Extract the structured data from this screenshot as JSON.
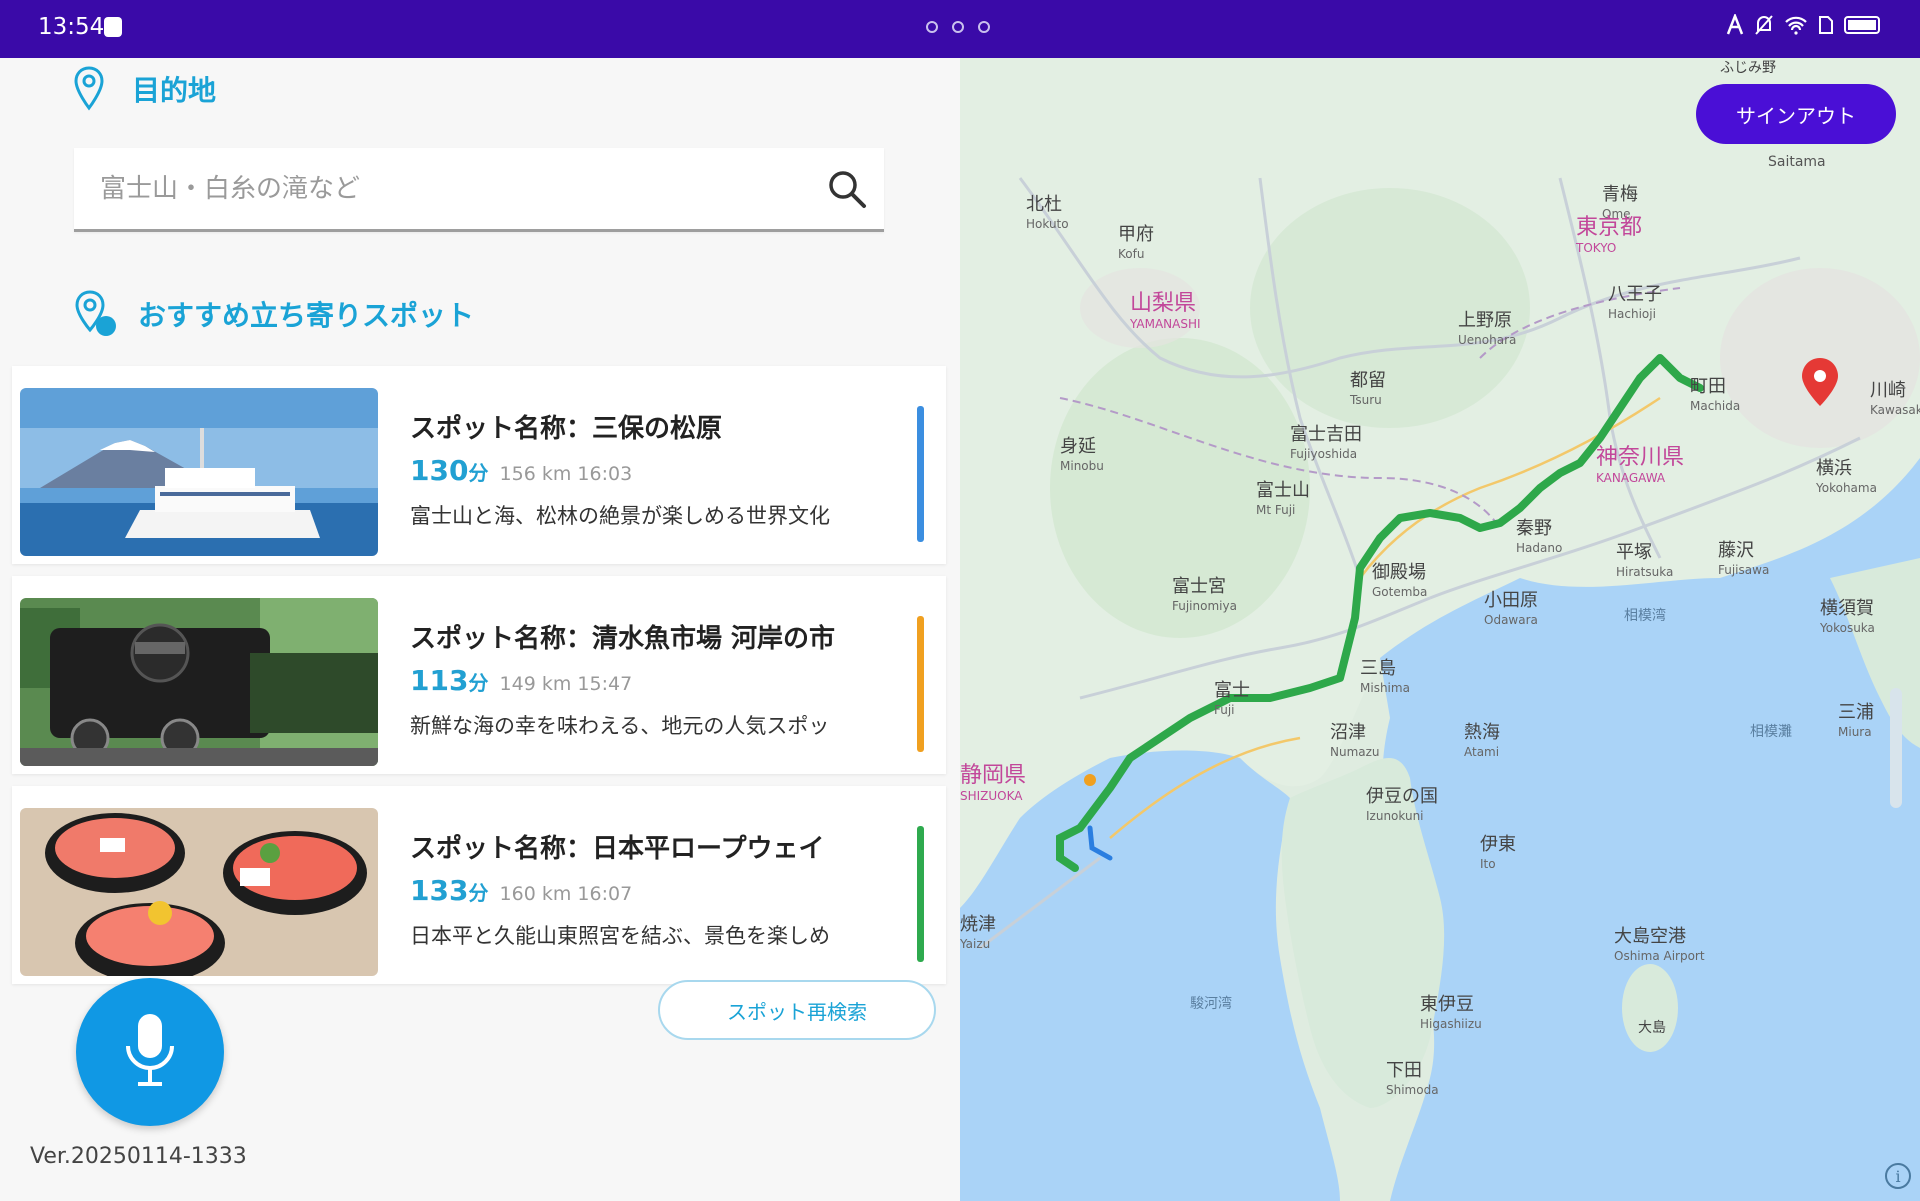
{
  "status_bar": {
    "time": "13:54"
  },
  "destination": {
    "label": "目的地",
    "search_placeholder": "富士山・白糸の滝など"
  },
  "recommended": {
    "label": "おすすめ立ち寄りスポット",
    "spots": [
      {
        "name": "スポット名称：三保の松原",
        "minutes": "130",
        "unit": "分",
        "distance_time": "156 km 16:03",
        "description": "富士山と海、松林の絶景が楽しめる世界文化",
        "accent": "#3b8ee0"
      },
      {
        "name": "スポット名称：清水魚市場 河岸の市",
        "minutes": "113",
        "unit": "分",
        "distance_time": "149 km 15:47",
        "description": "新鮮な海の幸を味わえる、地元の人気スポッ",
        "accent": "#f0a020"
      },
      {
        "name": "スポット名称：日本平ロープウェイ",
        "minutes": "133",
        "unit": "分",
        "distance_time": "160 km 16:07",
        "description": "日本平と久能山東照宮を結ぶ、景色を楽しめ",
        "accent": "#2eaa4e"
      }
    ]
  },
  "research_button": "スポット再検索",
  "version": "Ver.20250114-1333",
  "signout_button": "サインアウト",
  "map": {
    "labels": {
      "hokuto_ja": "北杜",
      "hokuto_en": "Hokuto",
      "kofu_ja": "甲府",
      "kofu_en": "Kofu",
      "yamanashi_ja": "山梨県",
      "yamanashi_en": "YAMANASHI",
      "ome_ja": "青梅",
      "ome_en": "Ome",
      "tokyo_ja": "東京都",
      "tokyo_en": "TOKYO",
      "hachioji_ja": "八王子",
      "hachioji_en": "Hachioji",
      "uenohara_ja": "上野原",
      "uenohara_en": "Uenohara",
      "tsuru_ja": "都留",
      "tsuru_en": "Tsuru",
      "fujiyoshida_ja": "富士吉田",
      "fujiyoshida_en": "Fujiyoshida",
      "minobu_ja": "身延",
      "minobu_en": "Minobu",
      "fujisan_ja": "富士山",
      "fujisan_en": "Mt Fuji",
      "fujinomiya_ja": "富士宮",
      "fujinomiya_en": "Fujinomiya",
      "gotemba_ja": "御殿場",
      "gotemba_en": "Gotemba",
      "machida_ja": "町田",
      "machida_en": "Machida",
      "kanagawa_ja": "神奈川県",
      "kanagawa_en": "KANAGAWA",
      "yokohama_ja": "横浜",
      "yokohama_en": "Yokohama",
      "kawasaki_ja": "川崎",
      "kawasaki_en": "Kawasaki",
      "hadano_ja": "秦野",
      "hadano_en": "Hadano",
      "hiratsuka_ja": "平塚",
      "hiratsuka_en": "Hiratsuka",
      "fujisawa_ja": "藤沢",
      "fujisawa_en": "Fujisawa",
      "odawara_ja": "小田原",
      "odawara_en": "Odawara",
      "sagamiwan": "相模湾",
      "yokosuka_ja": "横須賀",
      "yokosuka_en": "Yokosuka",
      "miura_ja": "三浦",
      "miura_en": "Miura",
      "fuji_ja": "富士",
      "fuji_en": "Fuji",
      "mishima_ja": "三島",
      "mishima_en": "Mishima",
      "numazu_ja": "沼津",
      "numazu_en": "Numazu",
      "atami_ja": "熱海",
      "atami_en": "Atami",
      "izunokuni_ja": "伊豆の国",
      "izunokuni_en": "Izunokuni",
      "ito_ja": "伊東",
      "ito_en": "Ito",
      "shizuoka_ja": "静岡県",
      "shizuoka_en": "SHIZUOKA",
      "yaizu_ja": "焼津",
      "yaizu_en": "Yaizu",
      "higashiizu_ja": "東伊豆",
      "higashiizu_en": "Higashiizu",
      "shimoda_ja": "下田",
      "shimoda_en": "Shimoda",
      "oshima_ja": "大島空港",
      "oshima_en": "Oshima Airport",
      "oshima_island": "大島",
      "surugawan": "駿河湾",
      "sagami_nada": "相模灘",
      "saitama_en": "Saitama",
      "fujimino": "ふじみ野"
    }
  }
}
